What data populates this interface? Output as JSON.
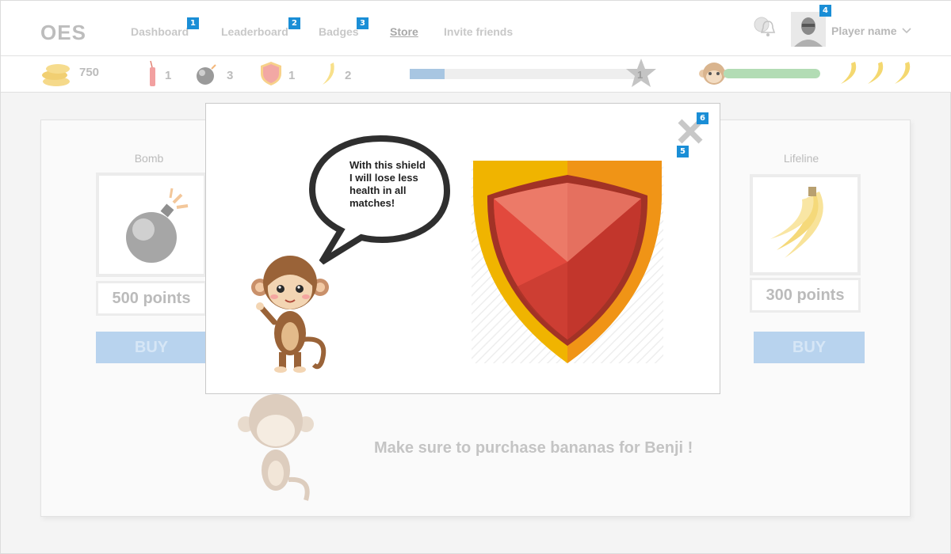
{
  "header": {
    "logo": "OES",
    "nav": [
      {
        "label": "Dashboard",
        "badge": "1"
      },
      {
        "label": "Leaderboard",
        "badge": "2"
      },
      {
        "label": "Badges",
        "badge": "3"
      },
      {
        "label": "Store"
      },
      {
        "label": "Invite friends"
      }
    ],
    "player_name": "Player name",
    "player_badge": "4"
  },
  "stats": {
    "coins": "750",
    "dynamite": "1",
    "bombs": "3",
    "shields": "1",
    "bananas": "2",
    "level": "1",
    "xp_progress": 0.15,
    "health_progress": 1.0,
    "banana_lives": 3
  },
  "store": {
    "items": [
      {
        "title": "Bomb",
        "price": "500 points",
        "buy": "BUY"
      },
      {
        "title": "Lifeline",
        "price": "300 points",
        "buy": "BUY"
      }
    ],
    "hint": "Make sure to purchase bananas for Benji !"
  },
  "modal": {
    "speech": "With this shield I will lose less health in all matches!",
    "badge_close_a": "5",
    "badge_close_b": "6"
  },
  "colors": {
    "accent_badge": "#1a8ed6",
    "buy_button": "#b8d3ee",
    "shield_red": "#d9433a",
    "shield_gold": "#f0b400"
  }
}
